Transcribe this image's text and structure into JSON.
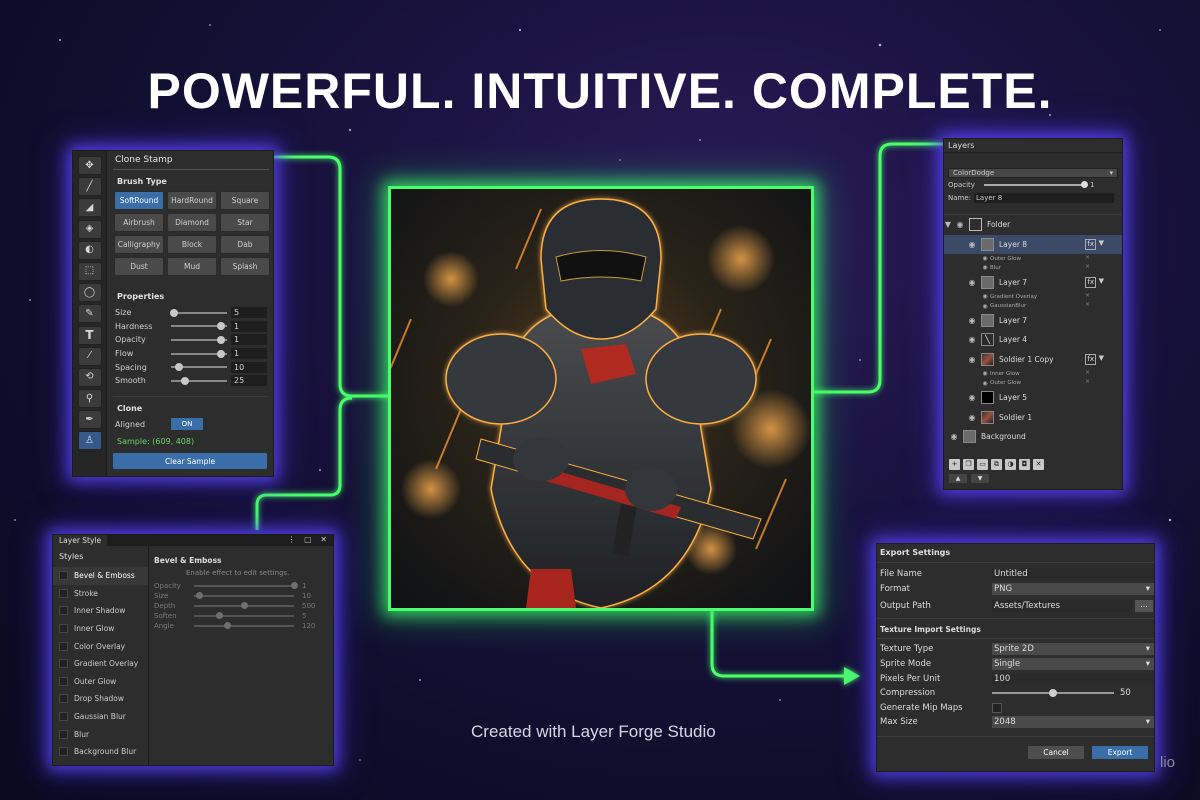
{
  "headline": "POWERFUL. INTUITIVE. COMPLETE.",
  "credit": "Created with Layer Forge Studio",
  "edge_fragment": "lio",
  "colors": {
    "accent_blue": "#3a6ea8",
    "connector_green": "#49ff6b",
    "panel_glow": "#5a46ff",
    "sample_green": "#6bd46b"
  },
  "clone_stamp": {
    "title": "Clone Stamp",
    "tools": [
      "move-icon",
      "brush-icon",
      "eraser-icon",
      "fill-bucket-icon",
      "color-replace-icon",
      "marquee-icon",
      "lasso-icon",
      "pencil-icon",
      "text-tool-icon",
      "eyedropper-icon",
      "transform-icon",
      "zoom-icon",
      "pen-tool-icon",
      "clone-stamp-icon"
    ],
    "tool_text": "T",
    "brush_type_title": "Brush Type",
    "brush_types": [
      "SoftRound",
      "HardRound",
      "Square",
      "Airbrush",
      "Diamond",
      "Star",
      "Calligraphy",
      "Block",
      "Dab",
      "Dust",
      "Mud",
      "Splash"
    ],
    "properties_title": "Properties",
    "properties": [
      {
        "label": "Size",
        "value": "5",
        "level": 0.05
      },
      {
        "label": "Hardness",
        "value": "1",
        "level": 0.9
      },
      {
        "label": "Opacity",
        "value": "1",
        "level": 0.9
      },
      {
        "label": "Flow",
        "value": "1",
        "level": 0.9
      },
      {
        "label": "Spacing",
        "value": "10",
        "level": 0.15
      },
      {
        "label": "Smooth",
        "value": "25",
        "level": 0.25
      }
    ],
    "clone_title": "Clone",
    "aligned_label": "Aligned",
    "aligned_toggle": "ON",
    "sample_text": "Sample: (609, 408)",
    "clear_button": "Clear Sample"
  },
  "layer_style": {
    "tab_title": "Layer Style",
    "window_icons": "⋮ ▢ ✕",
    "styles_title": "Styles",
    "styles": [
      "Bevel & Emboss",
      "Stroke",
      "Inner Shadow",
      "Inner Glow",
      "Color Overlay",
      "Gradient Overlay",
      "Outer Glow",
      "Drop Shadow",
      "Gaussian Blur",
      "Blur",
      "Background Blur"
    ],
    "section_title": "Bevel & Emboss",
    "hint": "Enable effect to edit settings.",
    "params": [
      {
        "label": "Opacity",
        "value": "1",
        "level": 1.0
      },
      {
        "label": "Size",
        "value": "10",
        "level": 0.05
      },
      {
        "label": "Depth",
        "value": "500",
        "level": 0.5
      },
      {
        "label": "Soften",
        "value": "5",
        "level": 0.25
      },
      {
        "label": "Angle",
        "value": "120",
        "level": 0.33
      }
    ]
  },
  "layers": {
    "title": "Layers",
    "blend_mode": "ColorDodge",
    "opacity_label": "Opacity",
    "opacity_value": "1",
    "opacity_level": 1.0,
    "name_label": "Name:",
    "name_value": "Layer 8",
    "rows": [
      {
        "type": "layer",
        "name": "Folder",
        "thumb": "folder",
        "indent": 0
      },
      {
        "type": "layer",
        "name": "Layer 8",
        "thumb": "gray",
        "indent": 1,
        "fx": true,
        "selected": true
      },
      {
        "type": "effect",
        "name": "Outer Glow"
      },
      {
        "type": "effect",
        "name": "Blur"
      },
      {
        "type": "layer",
        "name": "Layer 7",
        "thumb": "gray",
        "indent": 1,
        "fx": true
      },
      {
        "type": "effect",
        "name": "Gradient Overlay"
      },
      {
        "type": "effect",
        "name": "GaussianBlur"
      },
      {
        "type": "layer",
        "name": "Layer 7",
        "thumb": "gray",
        "indent": 1
      },
      {
        "type": "layer",
        "name": "Layer 4",
        "thumb": "brush",
        "indent": 1
      },
      {
        "type": "layer",
        "name": "Soldier 1 Copy",
        "thumb": "soldier",
        "indent": 1,
        "fx": true
      },
      {
        "type": "effect",
        "name": "Inner Glow"
      },
      {
        "type": "effect",
        "name": "Outer Glow"
      },
      {
        "type": "layer",
        "name": "Layer 5",
        "thumb": "black",
        "indent": 1
      },
      {
        "type": "layer",
        "name": "Soldier 1",
        "thumb": "soldier",
        "indent": 1
      },
      {
        "type": "layer",
        "name": "Background",
        "thumb": "gray",
        "indent": 0
      }
    ],
    "fx_label": "fx",
    "footer_icons": [
      "new-layer-icon",
      "duplicate-layer-icon",
      "new-folder-icon",
      "merge-icon",
      "adjustment-icon",
      "mask-icon",
      "delete-icon"
    ],
    "move_up": "▲",
    "move_down": "▼"
  },
  "export": {
    "title": "Export Settings",
    "file_name_label": "File Name",
    "file_name_value": "Untitled",
    "format_label": "Format",
    "format_value": "PNG",
    "output_path_label": "Output Path",
    "output_path_value": "Assets/Textures",
    "browse_label": "...",
    "texture_title": "Texture Import Settings",
    "texture_type_label": "Texture Type",
    "texture_type_value": "Sprite 2D",
    "sprite_mode_label": "Sprite Mode",
    "sprite_mode_value": "Single",
    "ppu_label": "Pixels Per Unit",
    "ppu_value": "100",
    "compression_label": "Compression",
    "compression_value": "50",
    "compression_level": 0.5,
    "mipmaps_label": "Generate Mip Maps",
    "max_size_label": "Max Size",
    "max_size_value": "2048",
    "cancel_button": "Cancel",
    "export_button": "Export"
  }
}
